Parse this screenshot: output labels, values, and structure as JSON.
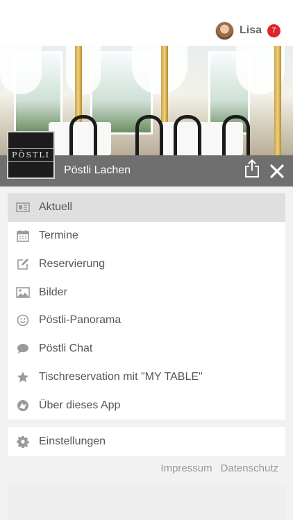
{
  "user": {
    "name": "Lisa",
    "notifications": "7"
  },
  "place": {
    "name": "Pöstli Lachen",
    "logo_text": "PÖSTLI"
  },
  "menu": [
    {
      "label": "Aktuell",
      "icon": "newspaper-icon"
    },
    {
      "label": "Termine",
      "icon": "calendar-icon"
    },
    {
      "label": "Reservierung",
      "icon": "edit-icon"
    },
    {
      "label": "Bilder",
      "icon": "image-icon"
    },
    {
      "label": "Pöstli-Panorama",
      "icon": "smiley-icon"
    },
    {
      "label": "Pöstli Chat",
      "icon": "chat-bubble-icon"
    },
    {
      "label": "Tischreservation mit \"MY TABLE\"",
      "icon": "star-icon"
    },
    {
      "label": "Über dieses App",
      "icon": "app-logo-icon"
    }
  ],
  "settings": {
    "label": "Einstellungen",
    "icon": "gear-icon"
  },
  "footer": {
    "impressum": "Impressum",
    "datenschutz": "Datenschutz"
  },
  "colors": {
    "badge": "#e0242b",
    "titlebar": "#646464",
    "active_item": "#dfdfdf",
    "icon": "#9a9a9a"
  }
}
